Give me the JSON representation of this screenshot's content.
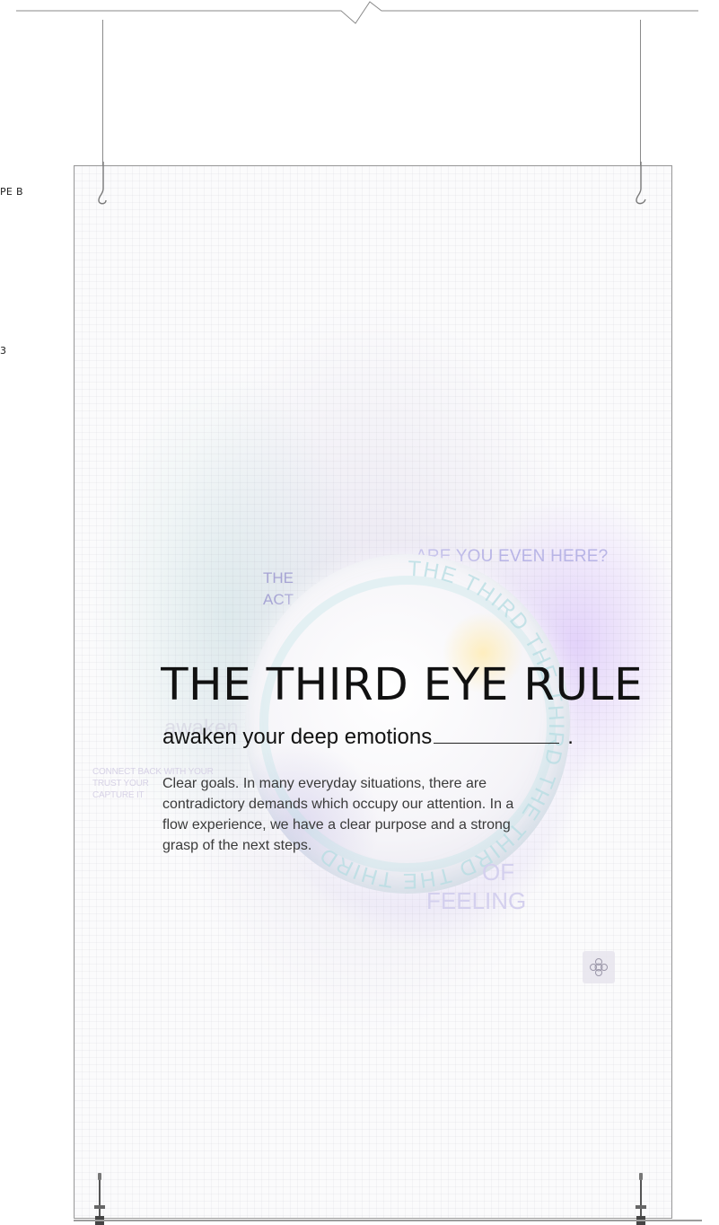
{
  "side_labels": {
    "top": "PE B",
    "middle": "3"
  },
  "poster": {
    "title": "THE THIRD EYE RULE",
    "subtitle": "awaken your deep emotions",
    "subtitle_end": ".",
    "body": "Clear goals. In many everyday situations, there are contradictory demands which occupy our attention. In a flow experience, we have a clear purpose and a strong grasp of the next steps.",
    "faint_question": "ARE YOU EVEN HERE?",
    "faint_the": "THE",
    "faint_act": "ACT",
    "faint_of": "OF",
    "faint_feeling": "FEELING",
    "faint_lines": [
      "CONNECT BACK WITH YOUR",
      "TRUST YOUR",
      "CAPTURE IT"
    ],
    "ring_text": "THE THIRD THE THIRD THE THIRD THE THIRD "
  },
  "icons": {
    "left_hook": "hook-icon",
    "right_hook": "hook-icon",
    "badge": "flower-sticker-icon",
    "stand": "stand-base-icon"
  },
  "colors": {
    "title": "#111111",
    "body": "#3a3a3a",
    "faint_lavender": "#b8b4e6",
    "ring_cyan": "#bfe3e6"
  }
}
